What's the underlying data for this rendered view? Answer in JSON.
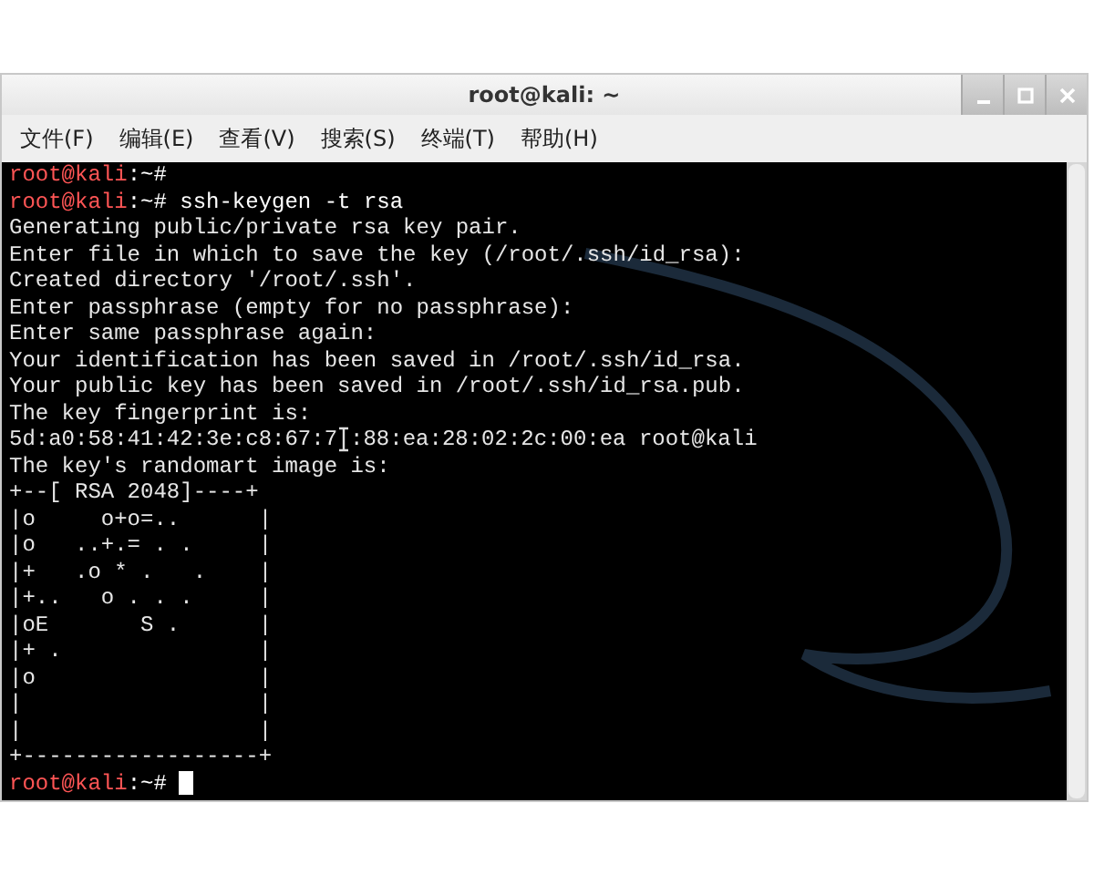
{
  "window": {
    "title": "root@kali: ~"
  },
  "menu": [
    {
      "label": "文件(F)"
    },
    {
      "label": "编辑(E)"
    },
    {
      "label": "查看(V)"
    },
    {
      "label": "搜索(S)"
    },
    {
      "label": "终端(T)"
    },
    {
      "label": "帮助(H)"
    }
  ],
  "terminal": {
    "lines": [
      {
        "kind": "prompt",
        "user": "root@kali",
        "suffix": ":~#"
      },
      {
        "kind": "prompt",
        "user": "root@kali",
        "suffix": ":~#",
        "command": " ssh-keygen -t rsa"
      },
      {
        "kind": "output",
        "text": "Generating public/private rsa key pair."
      },
      {
        "kind": "output",
        "text": "Enter file in which to save the key (/root/.ssh/id_rsa):"
      },
      {
        "kind": "output",
        "text": "Created directory '/root/.ssh'."
      },
      {
        "kind": "output",
        "text": "Enter passphrase (empty for no passphrase):"
      },
      {
        "kind": "output",
        "text": "Enter same passphrase again:"
      },
      {
        "kind": "output",
        "text": "Your identification has been saved in /root/.ssh/id_rsa."
      },
      {
        "kind": "output",
        "text": "Your public key has been saved in /root/.ssh/id_rsa.pub."
      },
      {
        "kind": "output",
        "text": "The key fingerprint is:"
      },
      {
        "kind": "split",
        "before": "5d:a0:58:41:42:3e:c8:67:7",
        "after": ":88:ea:28:02:2c:00:ea root@kali"
      },
      {
        "kind": "output",
        "text": "The key's randomart image is:"
      },
      {
        "kind": "art",
        "text": "+--[ RSA 2048]----+"
      },
      {
        "kind": "art",
        "text": "|o     o+o=..      |"
      },
      {
        "kind": "art",
        "text": "|o   ..+.= . .     |"
      },
      {
        "kind": "art",
        "text": "|+   .o * .   .    |"
      },
      {
        "kind": "art",
        "text": "|+..   o . . .     |"
      },
      {
        "kind": "art",
        "text": "|oE       S .      |"
      },
      {
        "kind": "art",
        "text": "|+ .               |"
      },
      {
        "kind": "art",
        "text": "|o                 |"
      },
      {
        "kind": "art",
        "text": "|                  |"
      },
      {
        "kind": "art",
        "text": "|                  |"
      },
      {
        "kind": "art",
        "text": "+------------------+"
      },
      {
        "kind": "prompt",
        "user": "root@kali",
        "suffix": ":~#",
        "cursor": true
      }
    ]
  }
}
